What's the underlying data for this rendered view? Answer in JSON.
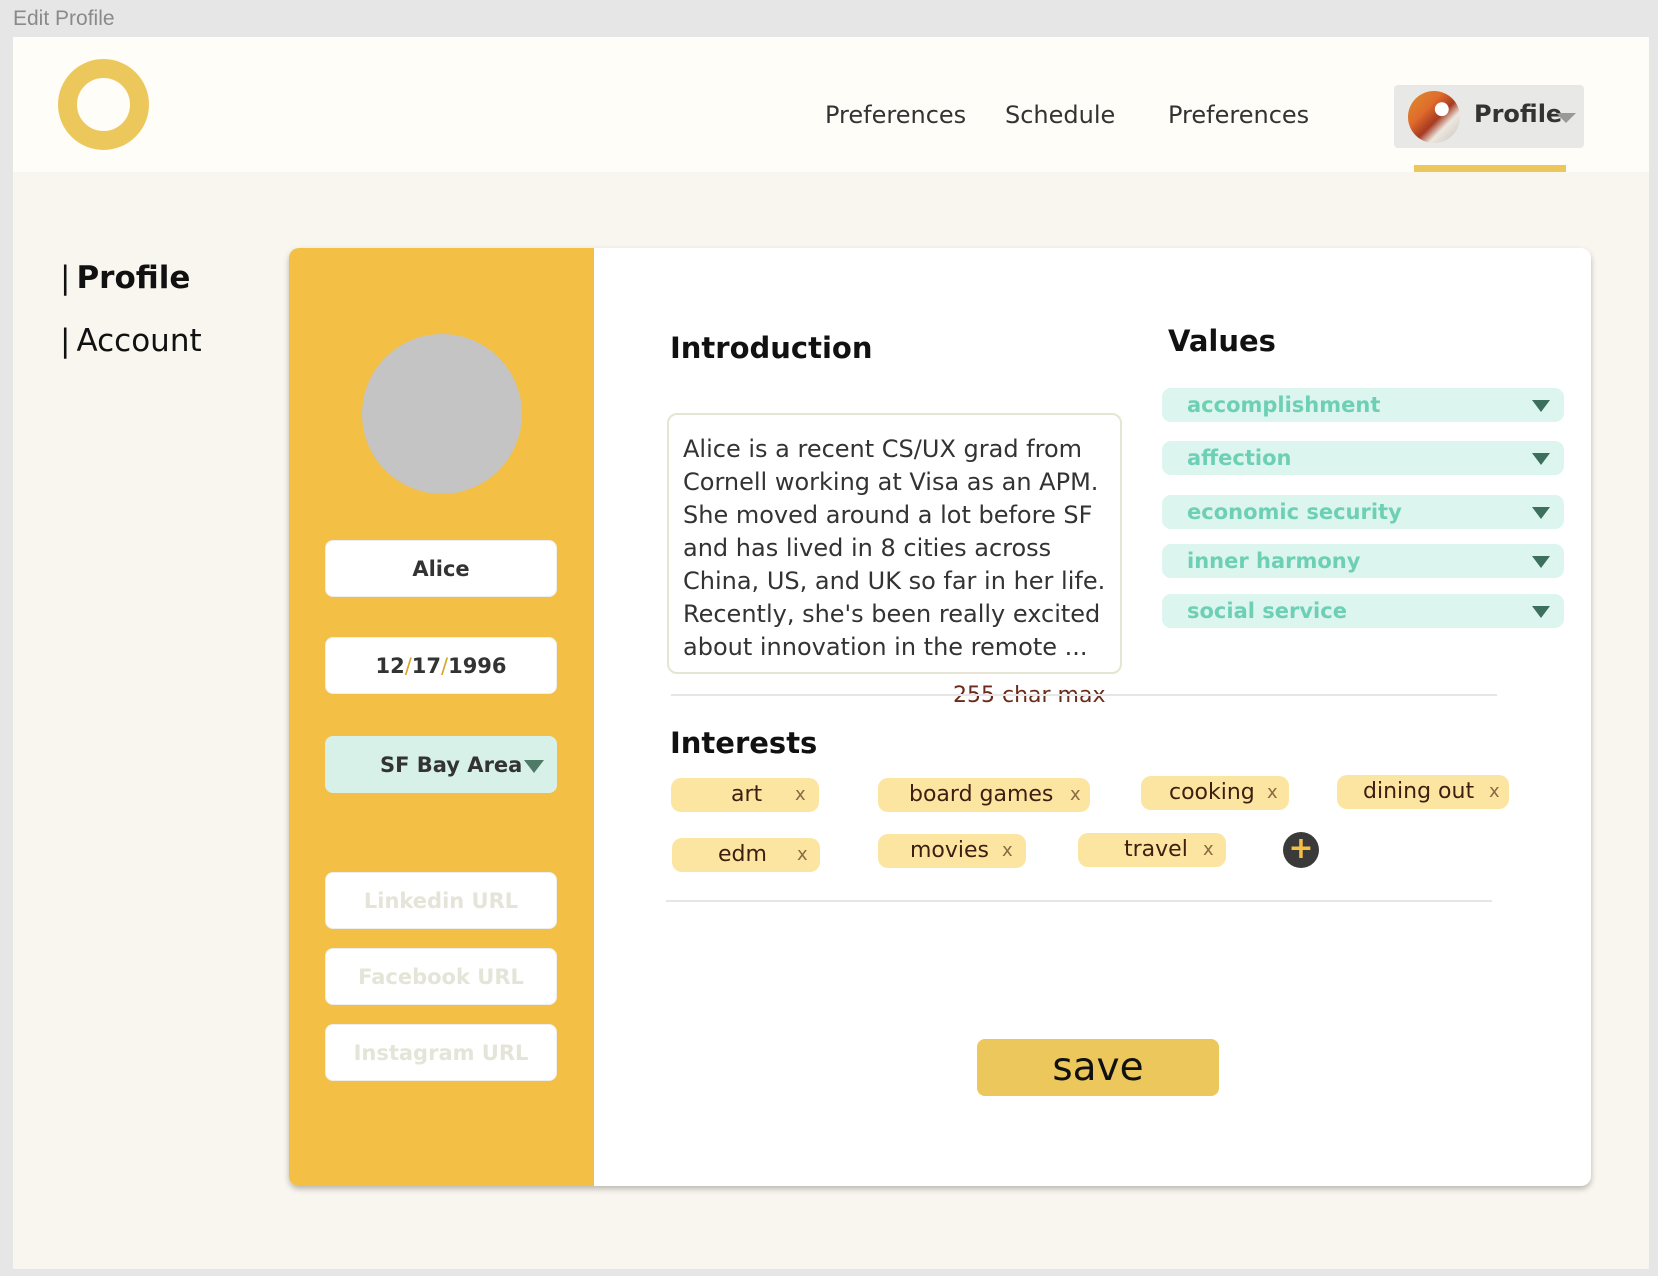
{
  "window": {
    "title": "Edit Profile"
  },
  "header": {
    "nav": [
      "Preferences",
      "Schedule",
      "Preferences"
    ],
    "profile_label": "Profile"
  },
  "sidebar": {
    "items": [
      {
        "label": "Profile"
      },
      {
        "label": "Account"
      }
    ]
  },
  "left_panel": {
    "name": "Alice",
    "dob": {
      "month": "12",
      "day": "17",
      "year": "1996"
    },
    "location": "SF Bay Area",
    "linkedin_placeholder": "Linkedin URL",
    "facebook_placeholder": "Facebook URL",
    "instagram_placeholder": "Instagram URL"
  },
  "introduction": {
    "title": "Introduction",
    "text": "Alice is a recent CS/UX grad from Cornell working at Visa as an APM. She moved around a lot before SF and has lived in 8 cities across China, US, and UK so far in her life. Recently, she's been really excited about innovation in the remote ...",
    "char_limit": "255 char max"
  },
  "values": {
    "title": "Values",
    "items": [
      "accomplishment",
      "affection",
      "economic security",
      "inner harmony",
      "social service"
    ]
  },
  "interests": {
    "title": "Interests",
    "items": [
      "art",
      "board games",
      "cooking",
      "dining out",
      "edm",
      "movies",
      "travel"
    ],
    "remove_symbol": "x",
    "add_symbol": "+"
  },
  "save_label": "save",
  "colors": {
    "accent_yellow": "#f3bf44",
    "logo": "#ecc85c",
    "chip": "#fbe5a1",
    "value_bg": "#dcf5ee",
    "value_text": "#6dd0b5"
  }
}
